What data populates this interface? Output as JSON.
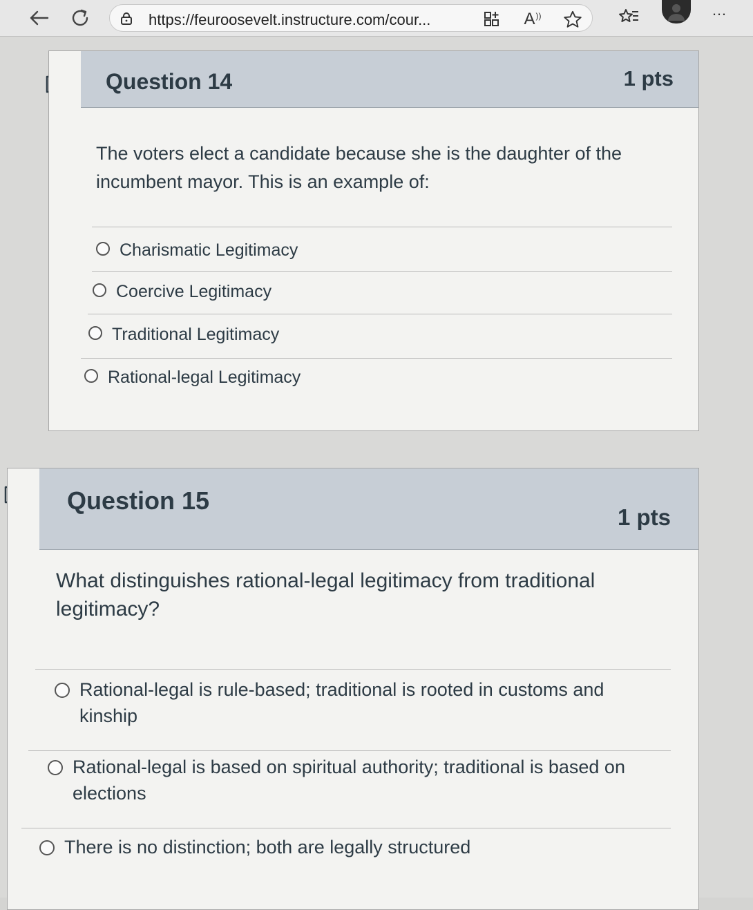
{
  "browser": {
    "url": "https://feuroosevelt.instructure.com/cour...",
    "read_aloud_label": "A",
    "more_label": "…"
  },
  "questions": [
    {
      "title": "Question 14",
      "points": "1 pts",
      "text": "The voters elect a candidate because she is the daughter of the incumbent mayor. This is an example of:",
      "answers": [
        "Charismatic Legitimacy",
        "Coercive Legitimacy",
        "Traditional Legitimacy",
        "Rational-legal Legitimacy"
      ]
    },
    {
      "title": "Question 15",
      "points": "1 pts",
      "text": "What distinguishes rational-legal legitimacy from traditional legitimacy?",
      "answers": [
        "Rational-legal is rule-based; traditional is rooted in customs and kinship",
        "Rational-legal is based on spiritual authority; traditional is based on elections",
        "There is no distinction; both are legally structured"
      ]
    }
  ],
  "icons": {
    "back": "arrow-left-icon",
    "refresh": "refresh-icon",
    "lock": "lock-icon",
    "apps": "grid-plus-icon",
    "read_aloud": "read-aloud-icon",
    "favorite": "star-icon",
    "favorites_list": "favorites-list-icon",
    "profile": "profile-avatar-icon",
    "flag": "bookmark-flag-icon"
  },
  "colors": {
    "header_bg": "#c7ced6",
    "text": "#2d3b45",
    "card_bg": "#f3f3f1"
  }
}
